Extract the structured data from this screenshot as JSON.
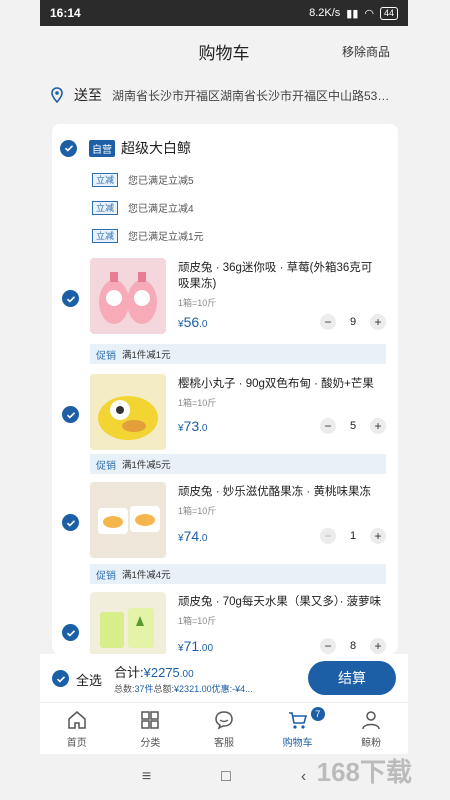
{
  "status": {
    "time": "16:14",
    "speed": "8.2K/s",
    "battery": "44"
  },
  "header": {
    "title": "购物车",
    "remove": "移除商品"
  },
  "address": {
    "label": "送至",
    "text": "湖南省长沙市开福区湖南省长沙市开福区中山路535号..."
  },
  "store": {
    "tag": "自营",
    "name": "超级大白鲸"
  },
  "promos": [
    {
      "tag": "立减",
      "text": "您已满足立减5"
    },
    {
      "tag": "立减",
      "text": "您已满足立减4"
    },
    {
      "tag": "立减",
      "text": "您已满足立减1元"
    }
  ],
  "items": [
    {
      "name": "顽皮兔 · 36g迷你吸 · 草莓(外箱36克可吸果冻)",
      "spec": "1箱=10斤",
      "price_symbol": "¥",
      "price_int": "56",
      "price_dec": ".0",
      "qty": "9",
      "minus": "−",
      "plus": "+"
    },
    {
      "name": "樱桃小丸子 · 90g双色布甸 · 酸奶+芒果",
      "spec": "1箱=10斤",
      "price_symbol": "¥",
      "price_int": "73",
      "price_dec": ".0",
      "qty": "5",
      "minus": "−",
      "plus": "+"
    },
    {
      "name": "顽皮兔 · 妙乐滋优酪果冻 · 黄桃味果冻",
      "spec": "1箱=10斤",
      "price_symbol": "¥",
      "price_int": "74",
      "price_dec": ".0",
      "qty": "1",
      "minus": "−",
      "plus": "+"
    },
    {
      "name": "顽皮兔 · 70g每天水果（果又多）· 菠萝味",
      "spec": "1箱=10斤",
      "price_symbol": "¥",
      "price_int": "71",
      "price_dec": ".00",
      "qty": "8",
      "minus": "−",
      "plus": "+"
    }
  ],
  "discounts": [
    {
      "tag": "促销",
      "text": "满1件减1元"
    },
    {
      "tag": "促销",
      "text": "满1件减5元"
    },
    {
      "tag": "促销",
      "text": "满1件减4元"
    }
  ],
  "footer": {
    "select_all": "全选",
    "total_label": "合计:",
    "total_symbol": "¥",
    "total_int": "2275",
    "total_dec": ".00",
    "summary_prefix": "总数:",
    "summary_count": "37件",
    "summary_amount_label": "总额:",
    "summary_amount": "¥2321.00优惠:-¥4...",
    "checkout": "结算"
  },
  "tabs": [
    {
      "label": "首页",
      "icon": "home-icon"
    },
    {
      "label": "分类",
      "icon": "category-icon"
    },
    {
      "label": "客服",
      "icon": "chat-icon"
    },
    {
      "label": "购物车",
      "icon": "cart-icon",
      "badge": "7",
      "active": true
    },
    {
      "label": "鲸粉",
      "icon": "user-icon"
    }
  ],
  "navbar": {
    "menu": "≡",
    "home": "□",
    "back": "‹"
  },
  "watermark": "168下载",
  "colors": {
    "accent": "#1d5fa6",
    "promo_bg": "#e9f1f8"
  }
}
